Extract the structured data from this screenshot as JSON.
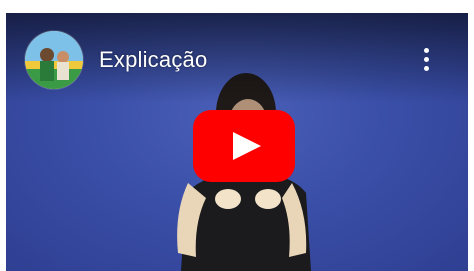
{
  "video": {
    "title": "Explicação"
  },
  "icons": {
    "avatar": "channel-avatar",
    "menu": "more-vert-icon",
    "play": "youtube-play-icon"
  },
  "colors": {
    "play_button": "#ff0000",
    "background": "#3a4fa8"
  }
}
